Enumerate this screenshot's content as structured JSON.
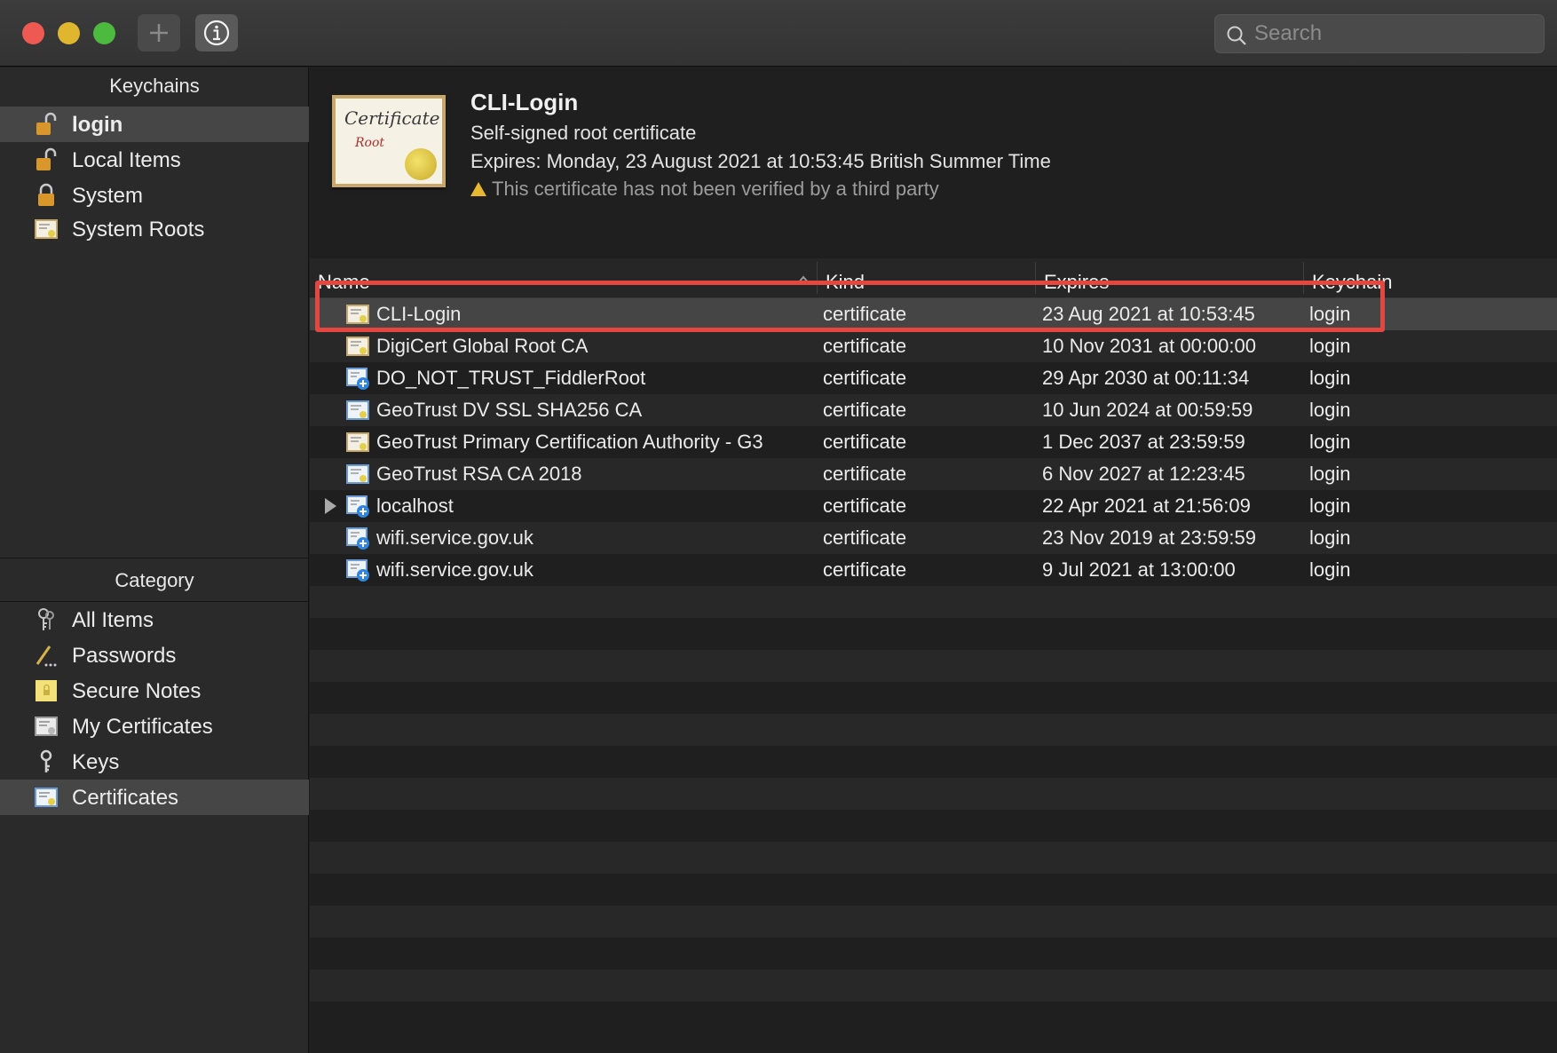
{
  "toolbar": {
    "add_icon": "plus-icon",
    "info_icon": "info-icon",
    "search_placeholder": "Search"
  },
  "sidebar": {
    "keychains_title": "Keychains",
    "keychains": [
      {
        "label": "login",
        "icon": "unlocked-padlock-icon",
        "selected": true
      },
      {
        "label": "Local Items",
        "icon": "unlocked-padlock-icon"
      },
      {
        "label": "System",
        "icon": "locked-padlock-icon"
      },
      {
        "label": "System Roots",
        "icon": "certificate-icon"
      }
    ],
    "category_title": "Category",
    "categories": [
      {
        "label": "All Items",
        "icon": "keys-icon"
      },
      {
        "label": "Passwords",
        "icon": "pen-icon"
      },
      {
        "label": "Secure Notes",
        "icon": "note-icon"
      },
      {
        "label": "My Certificates",
        "icon": "certificate-icon"
      },
      {
        "label": "Keys",
        "icon": "key-icon"
      },
      {
        "label": "Certificates",
        "icon": "certificate-icon",
        "selected": true
      }
    ]
  },
  "detail": {
    "title": "CLI-Login",
    "subtitle": "Self-signed root certificate",
    "expires": "Expires: Monday, 23 August 2021 at 10:53:45 British Summer Time",
    "warning": "This certificate has not been verified by a third party",
    "cert_image_text_1": "Certificate",
    "cert_image_text_2": "Root"
  },
  "table": {
    "columns": {
      "name": "Name",
      "kind": "Kind",
      "expires": "Expires",
      "keychain": "Keychain"
    },
    "rows": [
      {
        "name": "CLI-Login",
        "kind": "certificate",
        "expires": "23 Aug 2021 at 10:53:45",
        "keychain": "login",
        "icon": "root-certificate-icon",
        "selected": true
      },
      {
        "name": "DigiCert Global Root CA",
        "kind": "certificate",
        "expires": "10 Nov 2031 at 00:00:00",
        "keychain": "login",
        "icon": "root-certificate-icon"
      },
      {
        "name": "DO_NOT_TRUST_FiddlerRoot",
        "kind": "certificate",
        "expires": "29 Apr 2030 at 00:11:34",
        "keychain": "login",
        "icon": "trusted-certificate-icon"
      },
      {
        "name": "GeoTrust DV SSL SHA256 CA",
        "kind": "certificate",
        "expires": "10 Jun 2024 at 00:59:59",
        "keychain": "login",
        "icon": "intermediate-certificate-icon"
      },
      {
        "name": "GeoTrust Primary Certification Authority - G3",
        "kind": "certificate",
        "expires": "1 Dec 2037 at 23:59:59",
        "keychain": "login",
        "icon": "root-certificate-icon"
      },
      {
        "name": "GeoTrust RSA CA 2018",
        "kind": "certificate",
        "expires": "6 Nov 2027 at 12:23:45",
        "keychain": "login",
        "icon": "intermediate-certificate-icon"
      },
      {
        "name": "localhost",
        "kind": "certificate",
        "expires": "22 Apr 2021 at 21:56:09",
        "keychain": "login",
        "icon": "trusted-certificate-icon",
        "expandable": true
      },
      {
        "name": "wifi.service.gov.uk",
        "kind": "certificate",
        "expires": "23 Nov 2019 at 23:59:59",
        "keychain": "login",
        "icon": "trusted-certificate-icon"
      },
      {
        "name": "wifi.service.gov.uk",
        "kind": "certificate",
        "expires": "9 Jul 2021 at 13:00:00",
        "keychain": "login",
        "icon": "trusted-certificate-icon"
      }
    ]
  },
  "colors": {
    "highlight": "#e5463f",
    "selected_row": "#454545",
    "traffic_red": "#ee5a52",
    "traffic_yellow": "#e0b62f",
    "traffic_green": "#4cb93f"
  }
}
